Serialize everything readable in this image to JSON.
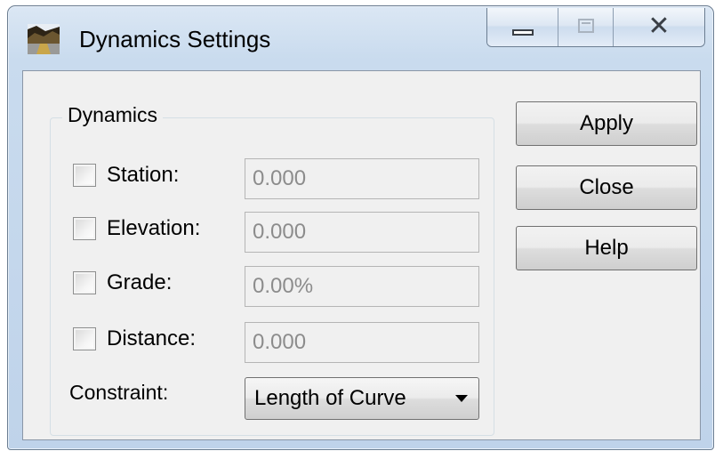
{
  "window": {
    "title": "Dynamics Settings",
    "controls": {
      "minimize": "minimize",
      "maximize": "maximize",
      "close": "close"
    }
  },
  "group": {
    "label": "Dynamics",
    "rows": [
      {
        "label": "Station:",
        "value": "0.000",
        "checked": false
      },
      {
        "label": "Elevation:",
        "value": "0.000",
        "checked": false
      },
      {
        "label": "Grade:",
        "value": "0.00%",
        "checked": false
      },
      {
        "label": "Distance:",
        "value": "0.000",
        "checked": false
      }
    ],
    "constraint_label": "Constraint:",
    "constraint_value": "Length of Curve"
  },
  "buttons": {
    "apply": "Apply",
    "close": "Close",
    "help": "Help"
  },
  "icons": {
    "app": "landscape-icon",
    "minimize": "minimize-icon",
    "maximize": "maximize-icon",
    "close": "close-icon",
    "dropdown": "dropdown-arrow-icon"
  }
}
